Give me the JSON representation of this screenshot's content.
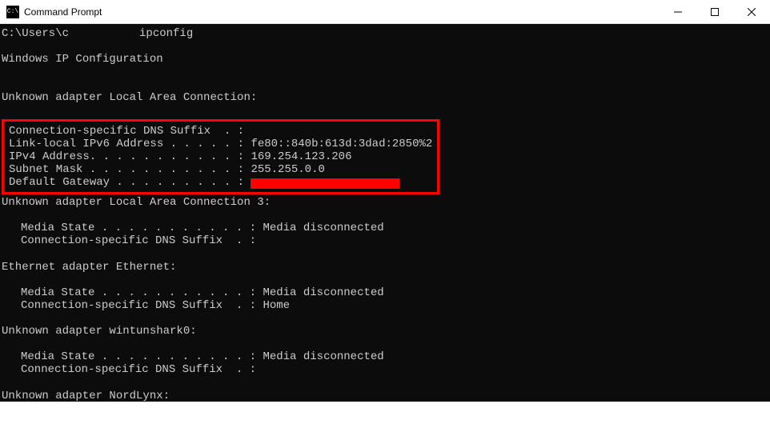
{
  "titlebar": {
    "icon_text": "C:\\",
    "title": "Command Prompt",
    "minimize": "—",
    "maximize": "▢",
    "close": "✕"
  },
  "console": {
    "prompt_prefix": "C:\\Users\\c",
    "prompt_command": "ipconfig",
    "header": "Windows IP Configuration",
    "adapters": [
      {
        "title": "Unknown adapter Local Area Connection:",
        "highlighted": true,
        "lines": [
          {
            "label": "Connection-specific DNS Suffix  . :",
            "value": ""
          },
          {
            "label": "Link-local IPv6 Address . . . . . :",
            "value": "fe80::840b:613d:3dad:2850%2"
          },
          {
            "label": "IPv4 Address. . . . . . . . . . . :",
            "value": "169.254.123.206"
          },
          {
            "label": "Subnet Mask . . . . . . . . . . . :",
            "value": "255.255.0.0"
          },
          {
            "label": "Default Gateway . . . . . . . . . :",
            "value_redacted": true
          }
        ]
      },
      {
        "title": "Unknown adapter Local Area Connection 3:",
        "lines": [
          {
            "label": "Media State . . . . . . . . . . . :",
            "value": "Media disconnected"
          },
          {
            "label": "Connection-specific DNS Suffix  . :",
            "value": ""
          }
        ]
      },
      {
        "title": "Ethernet adapter Ethernet:",
        "lines": [
          {
            "label": "Media State . . . . . . . . . . . :",
            "value": "Media disconnected"
          },
          {
            "label": "Connection-specific DNS Suffix  . :",
            "value": "Home"
          }
        ]
      },
      {
        "title": "Unknown adapter wintunshark0:",
        "lines": [
          {
            "label": "Media State . . . . . . . . . . . :",
            "value": "Media disconnected"
          },
          {
            "label": "Connection-specific DNS Suffix  . :",
            "value": ""
          }
        ]
      },
      {
        "title": "Unknown adapter NordLynx:",
        "lines": []
      }
    ]
  }
}
